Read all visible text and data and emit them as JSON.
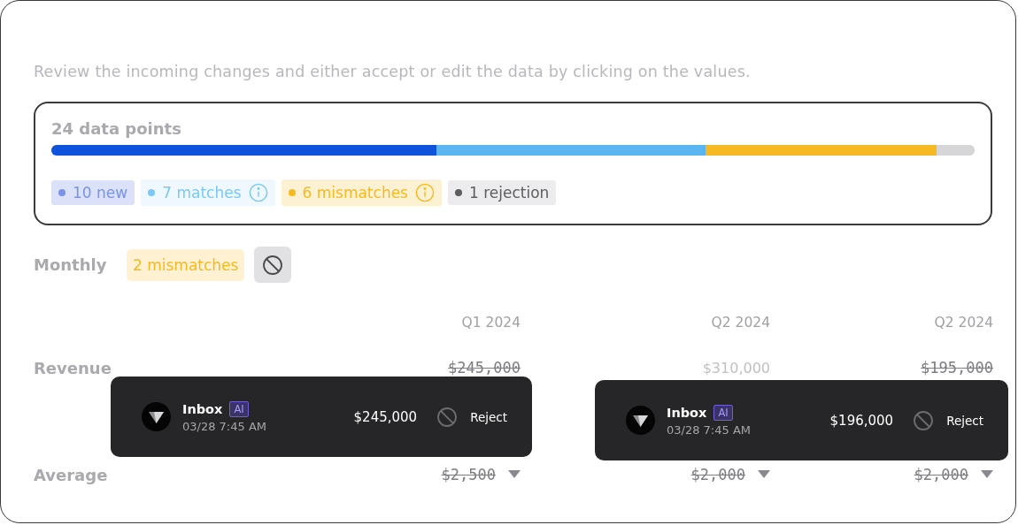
{
  "description": "Review the incoming changes and either accept or edit the data by clicking on the values.",
  "summary": {
    "title": "24 data points",
    "items": [
      {
        "kind": "added",
        "count": "10",
        "label": "new",
        "color": "#7b93e6",
        "info": false
      },
      {
        "kind": "match",
        "count": "7",
        "label": "matches",
        "color": "#7cc8f5",
        "info": true
      },
      {
        "kind": "mismatch",
        "count": "6",
        "label": "mismatches",
        "color": "#f6b921",
        "info": true
      },
      {
        "kind": "rejection",
        "count": "1",
        "label": "rejection",
        "color": "#5c5c61",
        "info": false
      }
    ]
  },
  "section": {
    "title": "Monthly",
    "badge": "2 mismatches"
  },
  "table": {
    "columns": [
      "Q1 2024",
      "Q2 2024",
      "Q2 2024"
    ],
    "rows": [
      {
        "label": "Revenue",
        "cells": [
          {
            "value": "$245,000",
            "struck": true,
            "dropdown": false
          },
          {
            "value": "$310,000",
            "struck": false,
            "dropdown": false
          },
          {
            "value": "$195,000",
            "struck": true,
            "dropdown": false
          }
        ]
      },
      {
        "label": "Average",
        "cells": [
          {
            "value": "$2,500",
            "struck": true,
            "dropdown": true
          },
          {
            "value": "$2,000",
            "struck": true,
            "dropdown": true
          },
          {
            "value": "$2,000",
            "struck": true,
            "dropdown": true
          }
        ]
      }
    ]
  },
  "popovers": [
    {
      "source": "Inbox",
      "badge": "AI",
      "time": "03/28 7:45 AM",
      "value": "$245,000",
      "action": "Reject"
    },
    {
      "source": "Inbox",
      "badge": "AI",
      "time": "03/28 7:45 AM",
      "value": "$196,000",
      "action": "Reject"
    }
  ]
}
